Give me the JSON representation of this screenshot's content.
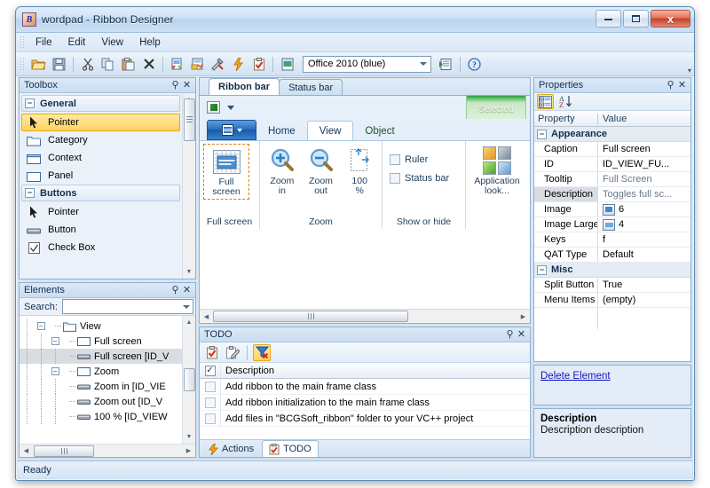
{
  "window": {
    "title": "wordpad - Ribbon Designer",
    "app_icon": "bcgsoft-b-icon",
    "caption_buttons": [
      {
        "name": "minimize-button",
        "glyph": "minimize-icon"
      },
      {
        "name": "maximize-button",
        "glyph": "maximize-icon"
      },
      {
        "name": "close-button",
        "glyph": "close-icon",
        "label": "x"
      }
    ]
  },
  "menubar": {
    "items": [
      "File",
      "Edit",
      "View",
      "Help"
    ]
  },
  "toolbar": {
    "buttons": [
      {
        "name": "open-button",
        "icon": "folder-open-icon"
      },
      {
        "name": "save-button",
        "icon": "floppy-disk-icon"
      },
      {
        "name": "cut-button",
        "icon": "scissors-icon"
      },
      {
        "name": "copy-button",
        "icon": "copy-icon"
      },
      {
        "name": "paste-button",
        "icon": "clipboard-paste-icon"
      },
      {
        "name": "delete-button",
        "icon": "x-cross-icon"
      },
      {
        "name": "new-category-button",
        "icon": "new-document-icon"
      },
      {
        "name": "new-panel-button",
        "icon": "panel-document-icon"
      },
      {
        "name": "tools-button",
        "icon": "hammer-wrench-icon"
      },
      {
        "name": "generate-button",
        "icon": "lightning-bolt-icon"
      },
      {
        "name": "todo-button",
        "icon": "clipboard-check-icon"
      },
      {
        "name": "preview-button",
        "icon": "window-preview-icon"
      }
    ],
    "style_combo": {
      "value": "Office 2010 (blue)"
    },
    "run_button": {
      "name": "run-preview-button",
      "icon": "run-arrow-icon"
    },
    "help_button": {
      "name": "help-button",
      "icon": "question-mark-icon"
    }
  },
  "toolbox": {
    "title": "Toolbox",
    "groups": [
      {
        "label": "General",
        "items": [
          {
            "label": "Pointer",
            "icon": "pointer-arrow-icon",
            "selected": true
          },
          {
            "label": "Category",
            "icon": "category-icon",
            "selected": false
          },
          {
            "label": "Context",
            "icon": "context-icon",
            "selected": false
          },
          {
            "label": "Panel",
            "icon": "panel-icon",
            "selected": false
          }
        ]
      },
      {
        "label": "Buttons",
        "items": [
          {
            "label": "Pointer",
            "icon": "pointer-arrow-icon",
            "selected": false
          },
          {
            "label": "Button",
            "icon": "button-icon",
            "selected": false
          },
          {
            "label": "Check Box",
            "icon": "checkbox-icon",
            "selected": false
          }
        ]
      }
    ]
  },
  "elements": {
    "title": "Elements",
    "search_label": "Search:",
    "search_value": "",
    "tree": [
      {
        "label": "View",
        "depth": 0,
        "icon": "category-icon",
        "expander": "-"
      },
      {
        "label": "Full screen",
        "depth": 1,
        "icon": "panel-icon",
        "expander": "-"
      },
      {
        "label": "Full screen [ID_V",
        "depth": 2,
        "icon": "button-icon",
        "expander": "",
        "selected": true
      },
      {
        "label": "Zoom",
        "depth": 1,
        "icon": "panel-icon",
        "expander": "-"
      },
      {
        "label": "Zoom in [ID_VIE",
        "depth": 2,
        "icon": "button-icon",
        "expander": ""
      },
      {
        "label": "Zoom out [ID_V",
        "depth": 2,
        "icon": "button-icon",
        "expander": ""
      },
      {
        "label": "100 % [ID_VIEW",
        "depth": 2,
        "icon": "button-icon",
        "expander": ""
      }
    ]
  },
  "designer": {
    "tabs": [
      {
        "label": "Ribbon bar",
        "active": true
      },
      {
        "label": "Status bar",
        "active": false
      }
    ],
    "ribbon": {
      "quick_access": {
        "icon": "qat-icon",
        "dropdown": "chevron-down-icon"
      },
      "app_button": {
        "name": "application-menu-button",
        "icon": "app-menu-icon"
      },
      "contextual_label": "Selected",
      "tabs": [
        {
          "label": "Home",
          "active": false,
          "contextual": false
        },
        {
          "label": "View",
          "active": true,
          "contextual": false
        },
        {
          "label": "Object",
          "active": false,
          "contextual": true
        }
      ],
      "panels": [
        {
          "caption": "Full screen",
          "type": "large-buttons",
          "buttons": [
            {
              "label": "Full\nscreen",
              "label_line1": "Full",
              "label_line2": "screen",
              "icon": "full-screen-icon",
              "selected": true
            }
          ]
        },
        {
          "caption": "Zoom",
          "type": "large-buttons",
          "buttons": [
            {
              "label_line1": "Zoom",
              "label_line2": "in",
              "icon": "zoom-in-icon",
              "selected": false
            },
            {
              "label_line1": "Zoom",
              "label_line2": "out",
              "icon": "zoom-out-icon",
              "selected": false
            },
            {
              "label_line1": "100",
              "label_line2": "%",
              "icon": "actual-size-icon",
              "selected": false
            }
          ]
        },
        {
          "caption": "Show or hide",
          "type": "checkboxes",
          "checkboxes": [
            {
              "label": "Ruler",
              "checked": false
            },
            {
              "label": "Status bar",
              "checked": false
            }
          ]
        },
        {
          "caption": "",
          "type": "large-buttons",
          "buttons": [
            {
              "label_line1": "Application",
              "label_line2": "look...",
              "icon": "application-look-icon",
              "selected": false
            }
          ]
        }
      ]
    }
  },
  "todo": {
    "title": "TODO",
    "toolbar": [
      {
        "name": "add-todo-button",
        "icon": "clipboard-add-icon",
        "active": false
      },
      {
        "name": "edit-todo-button",
        "icon": "clipboard-edit-icon",
        "active": false
      },
      {
        "name": "filter-todo-button",
        "icon": "filter-icon",
        "active": true
      }
    ],
    "column_header": "Description",
    "header_checked": true,
    "rows": [
      {
        "checked": false,
        "description": "Add ribbon to the main frame class"
      },
      {
        "checked": false,
        "description": "Add ribbon initialization to the main frame class"
      },
      {
        "checked": false,
        "description": "Add files in \"BCGSoft_ribbon\" folder to your VC++ project"
      }
    ],
    "bottom_tabs": [
      {
        "label": "Actions",
        "icon": "lightning-bolt-icon",
        "active": false
      },
      {
        "label": "TODO",
        "icon": "clipboard-check-icon",
        "active": true
      }
    ]
  },
  "properties": {
    "title": "Properties",
    "toolbar": [
      {
        "name": "categorized-view-button",
        "icon": "categorized-icon",
        "active": true
      },
      {
        "name": "alphabetical-sort-button",
        "icon": "sort-az-icon",
        "active": false
      }
    ],
    "columns": [
      "Property",
      "Value"
    ],
    "categories": [
      {
        "label": "Appearance",
        "rows": [
          {
            "name": "Caption",
            "value": "Full screen",
            "dim": false,
            "icon": null
          },
          {
            "name": "ID",
            "value": "ID_VIEW_FU...",
            "dim": false,
            "icon": null
          },
          {
            "name": "Tooltip",
            "value": "Full Screen",
            "dim": true,
            "icon": null
          },
          {
            "name": "Description",
            "value": "Toggles full sc...",
            "dim": true,
            "selected": true,
            "icon": null
          },
          {
            "name": "Image",
            "value": "6",
            "dim": false,
            "icon": "image-small-icon"
          },
          {
            "name": "Image Large",
            "value": "4",
            "dim": false,
            "icon": "image-large-icon"
          },
          {
            "name": "Keys",
            "value": "f",
            "dim": false,
            "icon": null
          },
          {
            "name": "QAT Type",
            "value": "Default",
            "dim": false,
            "icon": null
          }
        ]
      },
      {
        "label": "Misc",
        "rows": [
          {
            "name": "Split Button",
            "value": "True",
            "dim": false,
            "icon": null
          },
          {
            "name": "Menu Items",
            "value": "(empty)",
            "dim": false,
            "icon": null
          }
        ]
      }
    ],
    "delete_link": "Delete Element",
    "description_title": "Description",
    "description_text": "Description description"
  },
  "statusbar": {
    "text": "Ready"
  },
  "colors": {
    "accent_blue": "#2a6fc0",
    "selection_orange": "#ffd35e",
    "contextual_green": "#2c9b3f",
    "link_blue": "#1414c8",
    "frame_border": "#5b8bb5"
  }
}
